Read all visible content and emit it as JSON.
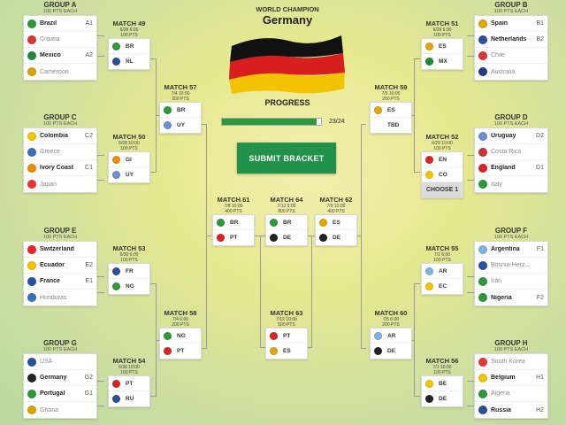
{
  "center": {
    "champion_title": "WORLD CHAMPION",
    "champion_name": "Germany",
    "progress_label": "PROGRESS",
    "progress_text": "23/24",
    "progress_fraction": 0.958,
    "submit_label": "SUBMIT BRACKET"
  },
  "colors": {
    "green": "#22914a",
    "connector": "#9a9a9a"
  },
  "groups": {
    "a": {
      "title": "GROUP A",
      "sub": "100 PTS EACH",
      "teams": [
        {
          "name": "Brazil",
          "pos": "A1",
          "style": "bold",
          "flag": "#2b9a3a"
        },
        {
          "name": "Croatia",
          "pos": "",
          "style": "dim",
          "flag": "#d33"
        },
        {
          "name": "Mexico",
          "pos": "A2",
          "style": "bold",
          "flag": "#1f8a3a"
        },
        {
          "name": "Cameroon",
          "pos": "",
          "style": "dim",
          "flag": "#d9a400"
        }
      ]
    },
    "b": {
      "title": "GROUP B",
      "sub": "100 PTS EACH",
      "teams": [
        {
          "name": "Spain",
          "pos": "B1",
          "style": "bold",
          "flag": "#e3a600"
        },
        {
          "name": "Netherlands",
          "pos": "B2",
          "style": "bold",
          "flag": "#2a4fa0"
        },
        {
          "name": "Chile",
          "pos": "",
          "style": "dim",
          "flag": "#d33"
        },
        {
          "name": "Australia",
          "pos": "",
          "style": "dim",
          "flag": "#233b8a"
        }
      ]
    },
    "c": {
      "title": "GROUP C",
      "sub": "100 PTS EACH",
      "teams": [
        {
          "name": "Colombia",
          "pos": "C2",
          "style": "bold",
          "flag": "#f2c500"
        },
        {
          "name": "Greece",
          "pos": "",
          "style": "dim",
          "flag": "#3d6fc2"
        },
        {
          "name": "Ivory Coast",
          "pos": "C1",
          "style": "bold",
          "flag": "#f08a00"
        },
        {
          "name": "Japan",
          "pos": "",
          "style": "dim",
          "flag": "#e33"
        }
      ]
    },
    "d": {
      "title": "GROUP D",
      "sub": "100 PTS EACH",
      "teams": [
        {
          "name": "Uruguay",
          "pos": "D2",
          "style": "bold",
          "flag": "#6b8ed6"
        },
        {
          "name": "Costa Rica",
          "pos": "",
          "style": "dim",
          "flag": "#c33"
        },
        {
          "name": "England",
          "pos": "D1",
          "style": "bold",
          "flag": "#d22"
        },
        {
          "name": "Italy",
          "pos": "",
          "style": "dim",
          "flag": "#2a9a3a"
        }
      ]
    },
    "e": {
      "title": "GROUP E",
      "sub": "100 PTS EACH",
      "teams": [
        {
          "name": "Switzerland",
          "pos": "",
          "style": "bold",
          "flag": "#e22"
        },
        {
          "name": "Ecuador",
          "pos": "E2",
          "style": "bold",
          "flag": "#f2c500"
        },
        {
          "name": "France",
          "pos": "E1",
          "style": "bold",
          "flag": "#2a4fa0"
        },
        {
          "name": "Honduras",
          "pos": "",
          "style": "dim",
          "flag": "#3b6fc2"
        }
      ]
    },
    "f": {
      "title": "GROUP F",
      "sub": "100 PTS EACH",
      "teams": [
        {
          "name": "Argentina",
          "pos": "F1",
          "style": "bold",
          "flag": "#7bb4e3"
        },
        {
          "name": "Bosnia-Herz...",
          "pos": "",
          "style": "dim",
          "flag": "#2a4fa0"
        },
        {
          "name": "Iran",
          "pos": "",
          "style": "dim",
          "flag": "#2a9a3a"
        },
        {
          "name": "Nigeria",
          "pos": "F2",
          "style": "bold",
          "flag": "#2a9a3a"
        }
      ]
    },
    "g": {
      "title": "GROUP G",
      "sub": "100 PTS EACH",
      "teams": [
        {
          "name": "USA",
          "pos": "",
          "style": "dim",
          "flag": "#2a4fa0"
        },
        {
          "name": "Germany",
          "pos": "G2",
          "style": "bold",
          "flag": "#222"
        },
        {
          "name": "Portugal",
          "pos": "G1",
          "style": "bold",
          "flag": "#2a9a3a"
        },
        {
          "name": "Ghana",
          "pos": "",
          "style": "dim",
          "flag": "#d9a400"
        }
      ]
    },
    "h": {
      "title": "GROUP H",
      "sub": "100 PTS EACH",
      "teams": [
        {
          "name": "South Korea",
          "pos": "",
          "style": "dim",
          "flag": "#e33"
        },
        {
          "name": "Belgium",
          "pos": "H1",
          "style": "bold",
          "flag": "#f2c500"
        },
        {
          "name": "Algeria",
          "pos": "",
          "style": "dim",
          "flag": "#2a9a3a"
        },
        {
          "name": "Russia",
          "pos": "H2",
          "style": "bold",
          "flag": "#2a4fa0"
        }
      ]
    }
  },
  "matches": {
    "m49": {
      "title": "MATCH 49",
      "date": "6/28 6:00",
      "pts": "100 PTS",
      "teams": [
        {
          "code": "BR",
          "flag": "#2b9a3a"
        },
        {
          "code": "NL",
          "flag": "#2a4fa0"
        }
      ]
    },
    "m50": {
      "title": "MATCH 50",
      "date": "6/28 10:00",
      "pts": "100 PTS",
      "teams": [
        {
          "code": "GI",
          "flag": "#f08a00"
        },
        {
          "code": "UY",
          "flag": "#6b8ed6"
        }
      ]
    },
    "m51": {
      "title": "MATCH 51",
      "date": "6/29 6:00",
      "pts": "100 PTS",
      "teams": [
        {
          "code": "ES",
          "flag": "#e3a600"
        },
        {
          "code": "MX",
          "flag": "#1f8a3a"
        }
      ]
    },
    "m52": {
      "title": "MATCH 52",
      "date": "6/29 10:00",
      "pts": "100 PTS",
      "teams": [
        {
          "code": "EN",
          "flag": "#d22"
        },
        {
          "code": "CO",
          "flag": "#f2c500"
        }
      ],
      "choose": "CHOOSE 1"
    },
    "m53": {
      "title": "MATCH 53",
      "date": "6/30 6:00",
      "pts": "100 PTS",
      "teams": [
        {
          "code": "FR",
          "flag": "#2a4fa0"
        },
        {
          "code": "NG",
          "flag": "#2a9a3a"
        }
      ]
    },
    "m54": {
      "title": "MATCH 54",
      "date": "6/30 10:00",
      "pts": "100 PTS",
      "teams": [
        {
          "code": "PT",
          "flag": "#d22"
        },
        {
          "code": "RU",
          "flag": "#2a4fa0"
        }
      ]
    },
    "m55": {
      "title": "MATCH 55",
      "date": "7/1 6:00",
      "pts": "100 PTS",
      "teams": [
        {
          "code": "AR",
          "flag": "#7bb4e3"
        },
        {
          "code": "EC",
          "flag": "#f2c500"
        }
      ]
    },
    "m56": {
      "title": "MATCH 56",
      "date": "7/1 10:00",
      "pts": "100 PTS",
      "teams": [
        {
          "code": "BE",
          "flag": "#f2c500"
        },
        {
          "code": "DE",
          "flag": "#222"
        }
      ]
    },
    "m57": {
      "title": "MATCH 57",
      "date": "7/4 10:00",
      "pts": "200 PTS",
      "teams": [
        {
          "code": "BR",
          "flag": "#2b9a3a"
        },
        {
          "code": "UY",
          "flag": "#6b8ed6"
        }
      ]
    },
    "m58": {
      "title": "MATCH 58",
      "date": "7/4 6:00",
      "pts": "200 PTS",
      "teams": [
        {
          "code": "NG",
          "flag": "#2a9a3a"
        },
        {
          "code": "PT",
          "flag": "#d22"
        }
      ]
    },
    "m59": {
      "title": "MATCH 59",
      "date": "7/5 10:00",
      "pts": "200 PTS",
      "teams": [
        {
          "code": "ES",
          "flag": "#e3a600"
        },
        {
          "code": "TBD",
          "flag": ""
        }
      ]
    },
    "m60": {
      "title": "MATCH 60",
      "date": "7/5 6:00",
      "pts": "200 PTS",
      "teams": [
        {
          "code": "AR",
          "flag": "#7bb4e3"
        },
        {
          "code": "DE",
          "flag": "#222"
        }
      ]
    },
    "m61": {
      "title": "MATCH 61",
      "date": "7/8 10:00",
      "pts": "400 PTS",
      "teams": [
        {
          "code": "BR",
          "flag": "#2b9a3a"
        },
        {
          "code": "PT",
          "flag": "#d22"
        }
      ]
    },
    "m62": {
      "title": "MATCH 62",
      "date": "7/9 10:00",
      "pts": "400 PTS",
      "teams": [
        {
          "code": "ES",
          "flag": "#e3a600"
        },
        {
          "code": "DE",
          "flag": "#222"
        }
      ]
    },
    "m63": {
      "title": "MATCH 63",
      "date": "7/12 10:00",
      "pts": "500 PTS",
      "teams": [
        {
          "code": "PT",
          "flag": "#d22"
        },
        {
          "code": "ES",
          "flag": "#e3a600"
        }
      ]
    },
    "m64": {
      "title": "MATCH 64",
      "date": "7/13 9:00",
      "pts": "800 PTS",
      "teams": [
        {
          "code": "BR",
          "flag": "#2b9a3a"
        },
        {
          "code": "DE",
          "flag": "#222"
        }
      ]
    }
  }
}
